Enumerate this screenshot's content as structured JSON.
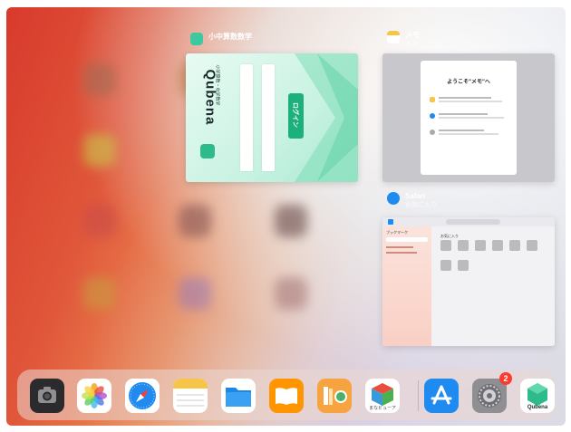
{
  "colors": {
    "qubena_green": "#3ec8a0",
    "memo_yellow": "#f6c548",
    "safari_blue": "#1f8af0",
    "badge_red": "#ff3b30"
  },
  "app_switcher": {
    "cards": [
      {
        "app_name": "小中算数数学",
        "subtitle": "",
        "icon": "qubena-icon",
        "content": {
          "brand": "Qubena",
          "tagline": "小学算数・中学数学",
          "login_label": "ログイン"
        }
      },
      {
        "app_name": "メモ",
        "subtitle": "メモ",
        "icon": "notes-icon",
        "content": {
          "welcome": "ようこそ\"メモ\"へ"
        }
      },
      {
        "app_name": "Safari",
        "subtitle": "お気に入り",
        "icon": "safari-icon",
        "content": {
          "sidebar_title": "ブックマーク",
          "favorites_title": "お気に入り"
        }
      }
    ]
  },
  "dock": {
    "apps": [
      {
        "name": "camera-icon"
      },
      {
        "name": "photos-icon"
      },
      {
        "name": "safari-icon"
      },
      {
        "name": "notes-icon"
      },
      {
        "name": "files-icon"
      },
      {
        "name": "books-icon"
      },
      {
        "name": "library-app-icon"
      },
      {
        "name": "manaview-icon",
        "label": "まなビューア"
      },
      {
        "name": "app-store-icon"
      },
      {
        "name": "settings-icon",
        "badge": "2"
      },
      {
        "name": "qubena-icon",
        "label": "Qubena"
      }
    ]
  }
}
